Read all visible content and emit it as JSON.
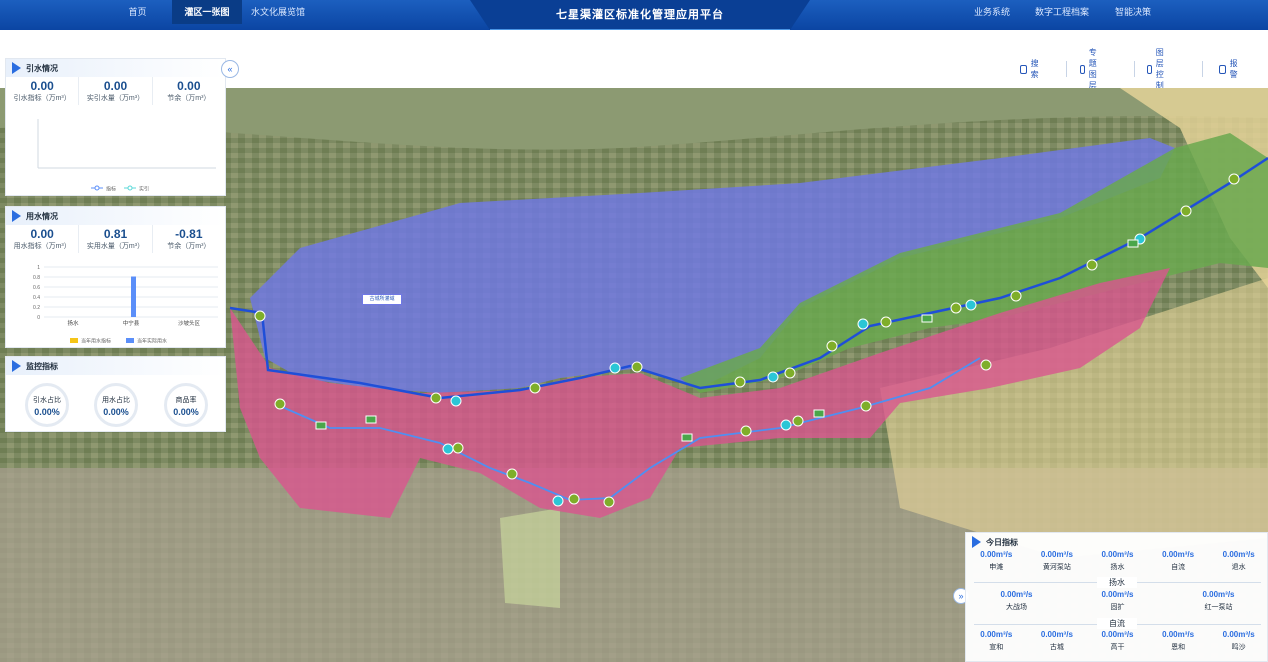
{
  "nav": {
    "left": [
      "首页",
      "灌区一张图",
      "水文化展览馆"
    ],
    "title": "七星渠灌区标准化管理应用平台",
    "right": [
      "业务系统",
      "数字工程档案",
      "智能决策"
    ]
  },
  "toolbar": [
    "搜索",
    "专题图层",
    "图层控制",
    "报警"
  ],
  "map": {
    "label": "古城所灌域"
  },
  "panel_inflow": {
    "title": "引水情况",
    "stats": [
      {
        "value": "0.00",
        "label": "引水指标（万m³）"
      },
      {
        "value": "0.00",
        "label": "实引水量（万m³）"
      },
      {
        "value": "0.00",
        "label": "节余（万m³）"
      }
    ],
    "legend": [
      "指标",
      "实引"
    ]
  },
  "panel_usage": {
    "title": "用水情况",
    "stats": [
      {
        "value": "0.00",
        "label": "用水指标（万m³）"
      },
      {
        "value": "0.81",
        "label": "实用水量（万m³）"
      },
      {
        "value": "-0.81",
        "label": "节余（万m³）"
      }
    ],
    "legend": [
      "当年用水指标",
      "当年实际用水"
    ]
  },
  "chart_data": {
    "type": "bar",
    "categories": [
      "扬水",
      "中宁县",
      "沙坡头区"
    ],
    "series": [
      {
        "name": "当年用水指标",
        "values": [
          0,
          0,
          0
        ]
      },
      {
        "name": "当年实际用水",
        "values": [
          0,
          0.81,
          0
        ]
      }
    ],
    "yticks": [
      "0",
      "0.2",
      "0.4",
      "0.6",
      "0.8",
      "1"
    ],
    "ylim": [
      0,
      1
    ],
    "colors": [
      "#f5c518",
      "#5b8ff9"
    ]
  },
  "panel_monitor": {
    "title": "监控指标",
    "gauges": [
      {
        "label": "引水占比",
        "value": "0.00%"
      },
      {
        "label": "用水占比",
        "value": "0.00%"
      },
      {
        "label": "商品率",
        "value": "0.00%"
      }
    ]
  },
  "collapse_glyph": "«",
  "expand_glyph": "»",
  "today": {
    "title": "今日指标",
    "row1": [
      {
        "value": "0.00m³/s",
        "label": "申滩"
      },
      {
        "value": "0.00m³/s",
        "label": "黄河泵站"
      },
      {
        "value": "0.00m³/s",
        "label": "扬水"
      },
      {
        "value": "0.00m³/s",
        "label": "自流"
      },
      {
        "value": "0.00m³/s",
        "label": "退水"
      }
    ],
    "section1": "扬水",
    "row2": [
      {
        "value": "0.00m³/s",
        "label": "大战场"
      },
      {
        "value": "0.00m³/s",
        "label": "固扩"
      },
      {
        "value": "0.00m³/s",
        "label": "红一泵站"
      }
    ],
    "section2": "自流",
    "row3": [
      {
        "value": "0.00m³/s",
        "label": "宣和"
      },
      {
        "value": "0.00m³/s",
        "label": "古城"
      },
      {
        "value": "0.00m³/s",
        "label": "高干"
      },
      {
        "value": "0.00m³/s",
        "label": "恩和"
      },
      {
        "value": "0.00m³/s",
        "label": "鸣沙"
      }
    ]
  },
  "colors": {
    "nav": "#0b45a3",
    "zone_blue": "#6f78e6",
    "zone_green": "#6aa84f",
    "zone_pink": "#d9558f",
    "zone_yellow": "#e8d69a",
    "canal": "#1f4fd8"
  }
}
